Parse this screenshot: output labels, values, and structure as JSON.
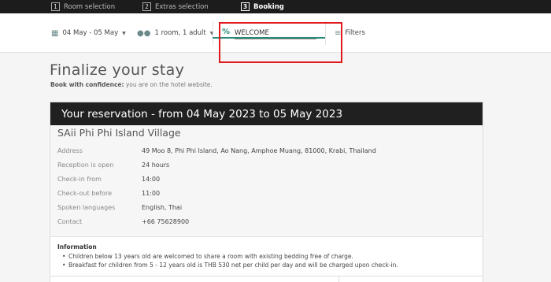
{
  "steps": [
    {
      "num": "1",
      "label": "Room selection"
    },
    {
      "num": "2",
      "label": "Extras selection"
    },
    {
      "num": "3",
      "label": "Booking"
    }
  ],
  "filterbar": {
    "dates_label": "04 May - 05 May",
    "guests_label": "1 room, 1 adult",
    "promo_symbol": "%",
    "promo_value": "WELCOME",
    "filters_label": "Filters"
  },
  "page": {
    "title": "Finalize your stay",
    "subtitle_bold": "Book with confidence:",
    "subtitle_rest": " you are on the hotel website."
  },
  "reservation": {
    "header": "Your reservation - from 04 May 2023 to 05 May 2023",
    "hotel_name": "SAii Phi Phi Island Village",
    "details": [
      {
        "key": "Address",
        "value": "49 Moo 8, Phi Phi Island, Ao Nang, Amphoe Muang, 81000, Krabi, Thailand"
      },
      {
        "key": "Reception is open",
        "value": "24 hours"
      },
      {
        "key": "Check-in from",
        "value": "14:00"
      },
      {
        "key": "Check-out before",
        "value": "11:00"
      },
      {
        "key": "Spoken languages",
        "value": "English, Thai"
      },
      {
        "key": "Contact",
        "value": "+66 75628900"
      }
    ],
    "info_title": "Information",
    "info_items": [
      "Children below 13 years old are welcomed to share a room with existing bedding free of charge.",
      "Breakfast for children from 5 - 12 years old is THB 530 net per child per day and will be charged upon check-in."
    ]
  },
  "colors": {
    "accent": "#2a8a7a",
    "highlight": "#e0191f",
    "header_bg": "#1c1c1c"
  }
}
